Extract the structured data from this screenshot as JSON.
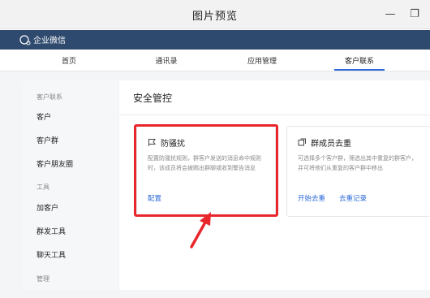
{
  "window": {
    "title": "图片预览"
  },
  "app": {
    "brand": "企业微信"
  },
  "nav": {
    "tabs": [
      {
        "label": "首页"
      },
      {
        "label": "通讯录"
      },
      {
        "label": "应用管理"
      },
      {
        "label": "客户联系"
      }
    ],
    "active": "客户联系"
  },
  "sidebar": {
    "group_customer": "客户联系",
    "item_customer": "客户",
    "item_customer_group": "客户群",
    "item_moments": "客户朋友圈",
    "group_tools": "工具",
    "item_add_customer": "加客户",
    "item_mass_tool": "群发工具",
    "item_chat_tool": "聊天工具",
    "group_manage": "管理"
  },
  "main": {
    "title": "安全管控",
    "card_a": {
      "icon": "anti-harassment-icon",
      "title": "防骚扰",
      "desc": "配置防骚扰规则，群客户发送的消息命中规则时，该成员将会被踢出群聊或收到警告消息",
      "link": "配置"
    },
    "card_b": {
      "icon": "dedupe-icon",
      "title": "群成员去重",
      "desc": "可选择多个客户群，筛选出其中重复的群客户，并可将他们从重复的客户群中移出",
      "link_start": "开始去重",
      "link_records": "去重记录"
    }
  },
  "colors": {
    "header": "#2e4a6e",
    "accent": "#2d6ad8",
    "highlight": "#e8262b"
  }
}
